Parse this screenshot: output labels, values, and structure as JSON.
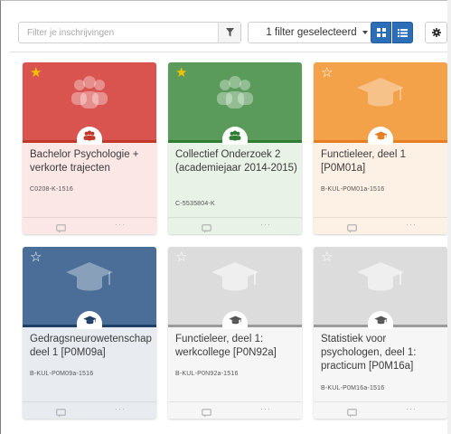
{
  "toolbar": {
    "search_placeholder": "Filter je inschrijvingen",
    "filter_label": "1 filter geselecteerd",
    "icons": [
      "funnel-icon",
      "grid-view-icon",
      "list-view-icon",
      "gear-icon"
    ],
    "accent_color": "#2c6fb8"
  },
  "courses": [
    {
      "title": "Bachelor Psychologie + verkorte trajecten",
      "code": "C0208-K-1516",
      "starred": true,
      "icon": "group-icon",
      "top_color": "#d9534f",
      "band_color": "#c0392b",
      "bottom_color": "#fbe7e6"
    },
    {
      "title": "Collectief Onderzoek 2 (academiejaar 2014-2015)",
      "code": "C-5535804-K",
      "starred": true,
      "icon": "group-icon",
      "top_color": "#5a9a5a",
      "band_color": "#2e7d32",
      "bottom_color": "#e8f2e6"
    },
    {
      "title": "Functieleer, deel 1 [P0M01a]",
      "code": "B-KUL-P0M01a-1516",
      "starred": false,
      "icon": "graduation-cap-icon",
      "top_color": "#f3a24a",
      "band_color": "#e67e22",
      "bottom_color": "#fdf1e5"
    },
    {
      "title": "Gedragsneurowetenschap deel 1 [P0M09a]",
      "code": "B-KUL-P0M09a-1516",
      "starred": false,
      "icon": "graduation-cap-icon",
      "top_color": "#4a6e97",
      "band_color": "#1f3f66",
      "bottom_color": "#e8ecf1"
    },
    {
      "title": "Functieleer, deel 1: werkcollege [P0N92a]",
      "code": "B-KUL-P0N92a-1516",
      "starred": false,
      "icon": "graduation-cap-icon",
      "top_color": "#dcdcdc",
      "band_color": "#9b9b9b",
      "bottom_color": "#f6f6f6"
    },
    {
      "title": "Statistiek voor psychologen, deel 1: practicum [P0M16a]",
      "code": "B-KUL-P0M16a-1516",
      "starred": false,
      "icon": "graduation-cap-icon",
      "top_color": "#dcdcdc",
      "band_color": "#9b9b9b",
      "bottom_color": "#f6f6f6"
    }
  ],
  "card_footer": {
    "more_label": "···"
  }
}
